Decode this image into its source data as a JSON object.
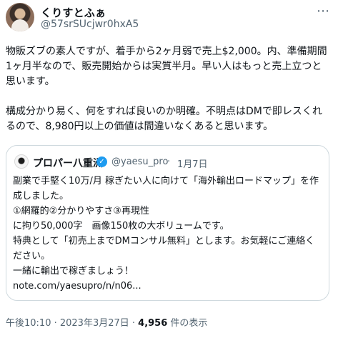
{
  "author": {
    "display_name": "くりすとふぁ",
    "handle": "@57srSUcjwr0hxA5"
  },
  "tweet": {
    "text": "物販ズブの素人ですが、着手から2ヶ月弱で売上$2,000。内、準備期間1ヶ月半なので、販売開始からは実質半月。早い人はもっと売上立つと思います。\n\n構成分かり易く、何をすれば良いのか明確。不明点はDMで即レスくれるので、8,980円以上の価値は間違いなくあると思います。"
  },
  "quote": {
    "display_name": "プロパー八重洲",
    "handle": "@yaesu_pro",
    "separator": "·",
    "date": "1月7日",
    "text": "副業で手堅く10万/月 稼ぎたい人に向けて「海外輸出ロードマップ」を作成しました。\n①網羅的②分かりやすさ③再現性\nに拘り50,000字　画像150枚の大ボリュームです。\n特典として「初売上までDMコンサル無料」とします。お気軽にご連絡ください。\n一緒に輸出で稼ぎましょう！\nnote.com/yaesupro/n/n06..."
  },
  "meta": {
    "time_date": "午後10:10 · 2023年3月27日 · ",
    "view_count": "4,956",
    "view_suffix": " 件の表示"
  },
  "icons": {
    "more": "more-horizontal-icon",
    "verified": "verified-badge-icon"
  },
  "colors": {
    "text": "#0f1419",
    "secondary": "#536471",
    "border": "#cfd9de",
    "verified": "#1d9bf0"
  }
}
